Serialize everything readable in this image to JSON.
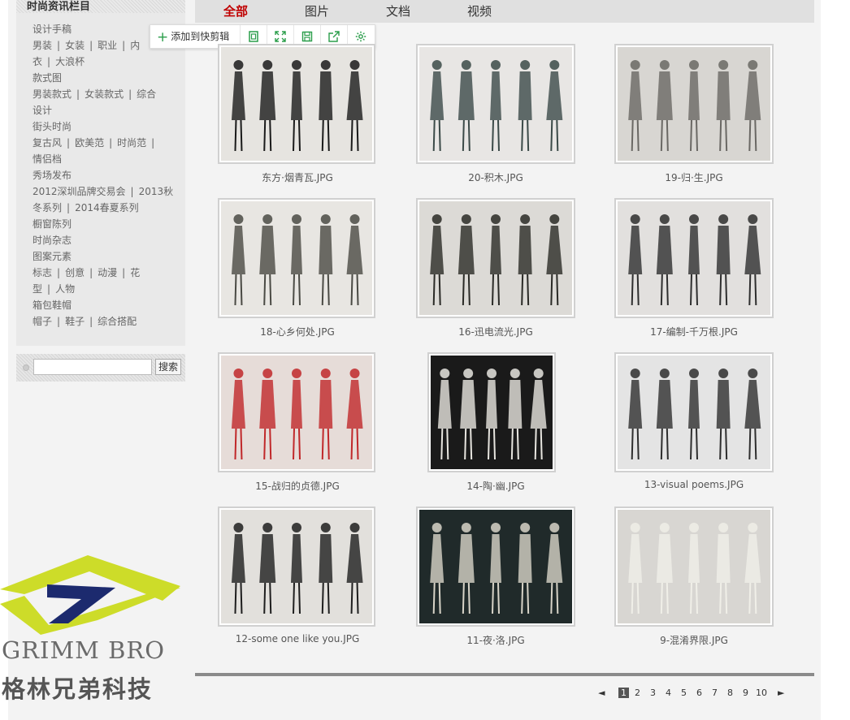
{
  "sidebar": {
    "title": "时尚资讯栏目",
    "menu": [
      {
        "type": "head",
        "text": "设计手稿"
      },
      {
        "type": "sub",
        "parts": [
          "男装",
          "女装",
          "职业",
          "内"
        ]
      },
      {
        "type": "sub",
        "parts": [
          "衣",
          "大浪杯"
        ]
      },
      {
        "type": "head",
        "text": "款式图"
      },
      {
        "type": "sub",
        "parts": [
          "男装款式",
          "女装款式",
          "综合"
        ]
      },
      {
        "type": "sub",
        "parts": [
          "设计"
        ]
      },
      {
        "type": "head",
        "text": "街头时尚"
      },
      {
        "type": "sub",
        "parts": [
          "复古风",
          "欧美范",
          "时尚范",
          ""
        ]
      },
      {
        "type": "sub",
        "parts": [
          "情侣档"
        ]
      },
      {
        "type": "head",
        "text": "秀场发布"
      },
      {
        "type": "sub",
        "parts": [
          "2012深圳品牌交易会",
          "2013秋"
        ]
      },
      {
        "type": "sub",
        "parts": [
          "冬系列",
          "2014春夏系列"
        ]
      },
      {
        "type": "head",
        "text": "橱窗陈列"
      },
      {
        "type": "head",
        "text": "时尚杂志"
      },
      {
        "type": "head",
        "text": "图案元素"
      },
      {
        "type": "sub",
        "parts": [
          "标志",
          "创意",
          "动漫",
          "花"
        ]
      },
      {
        "type": "sub",
        "parts": [
          "型",
          "人物"
        ]
      },
      {
        "type": "head",
        "text": "箱包鞋帽"
      },
      {
        "type": "sub",
        "parts": [
          "帽子",
          "鞋子",
          "综合搭配"
        ]
      }
    ],
    "search": {
      "placeholder": "",
      "button": "搜索"
    }
  },
  "tabs": [
    "全部",
    "图片",
    "文档",
    "视频"
  ],
  "active_tab": "全部",
  "toolbar": {
    "add_label": "添加到快剪辑",
    "icons": [
      "copy-icon",
      "fullscreen-icon",
      "save-icon",
      "share-icon",
      "settings-icon"
    ]
  },
  "gallery": [
    {
      "caption": "东方·烟青瓦.JPG",
      "bg": "#e6e4e0",
      "fig": "#1a1a1a"
    },
    {
      "caption": "20-积木.JPG",
      "bg": "#e8e6e4",
      "fig": "#3b4a48"
    },
    {
      "caption": "19-归·生.JPG",
      "bg": "#d8d6d2",
      "fig": "#6a6864"
    },
    {
      "caption": "18-心乡何处.JPG",
      "bg": "#e8e6e2",
      "fig": "#4a4a44"
    },
    {
      "caption": "16-迅电流光.JPG",
      "bg": "#dcdad6",
      "fig": "#2a2a26"
    },
    {
      "caption": "17-编制-千万根.JPG",
      "bg": "#e2e0de",
      "fig": "#2e2e2e"
    },
    {
      "caption": "15-战归的贞德.JPG",
      "bg": "#e6dcd8",
      "fig": "#c0282a"
    },
    {
      "caption": "14-陶·幽.JPG",
      "bg": "#1a1a1a",
      "fig": "#e8e6e0"
    },
    {
      "caption": "13-visual poems.JPG",
      "bg": "#e4e4e4",
      "fig": "#2e2e2e"
    },
    {
      "caption": "12-some one like you.JPG",
      "bg": "#e2e0dc",
      "fig": "#1e1e1e"
    },
    {
      "caption": "11-夜·洛.JPG",
      "bg": "#202a2a",
      "fig": "#d8d4c8"
    },
    {
      "caption": "9-混淆界限.JPG",
      "bg": "#d8d6d2",
      "fig": "#f0efe8"
    }
  ],
  "pagination": {
    "current": "1",
    "pages": [
      "1",
      "2",
      "3",
      "4",
      "5",
      "6",
      "7",
      "8",
      "9",
      "10"
    ],
    "prev": "◄",
    "next": "►"
  },
  "logo": {
    "text": "GRIMM BRO",
    "subtitle": "格林兄弟科技",
    "color_lime": "#cddc29",
    "color_navy": "#1c2a6e"
  }
}
